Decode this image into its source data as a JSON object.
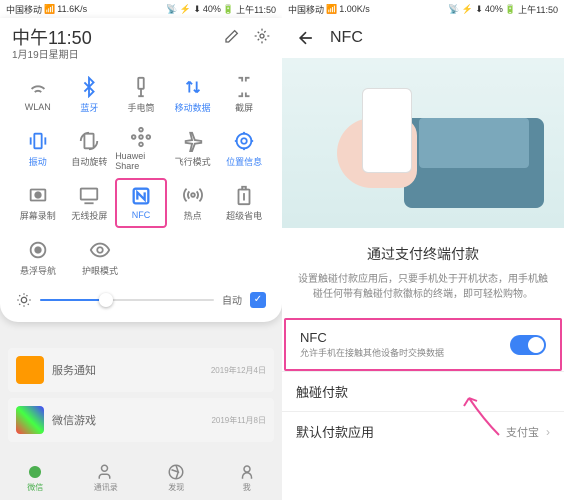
{
  "status": {
    "carrier": "中国移动",
    "speed_left": "11.6K/s",
    "speed_right": "1.00K/s",
    "battery": "40%",
    "time": "上午11:50"
  },
  "panel": {
    "time": "中午11:50",
    "date": "1月19日星期日",
    "tiles": [
      {
        "label": "WLAN",
        "active": false
      },
      {
        "label": "蓝牙",
        "active": true
      },
      {
        "label": "手电筒",
        "active": false
      },
      {
        "label": "移动数据",
        "active": true
      },
      {
        "label": "截屏",
        "active": false
      },
      {
        "label": "振动",
        "active": true
      },
      {
        "label": "自动旋转",
        "active": false
      },
      {
        "label": "Huawei Share",
        "active": false
      },
      {
        "label": "飞行模式",
        "active": false
      },
      {
        "label": "位置信息",
        "active": true
      },
      {
        "label": "屏幕录制",
        "active": false
      },
      {
        "label": "无线投屏",
        "active": false
      },
      {
        "label": "NFC",
        "active": true,
        "highlight": true
      },
      {
        "label": "热点",
        "active": false
      },
      {
        "label": "超级省电",
        "active": false
      }
    ],
    "floating": [
      {
        "label": "悬浮导航"
      },
      {
        "label": "护眼模式"
      }
    ],
    "brightness": {
      "auto_label": "自动",
      "auto_checked": true
    }
  },
  "bg": {
    "items": [
      {
        "title": "服务通知",
        "sub": "",
        "date": "2019年12月4日"
      },
      {
        "title": "微信游戏",
        "sub": "",
        "date": "2019年11月8日"
      }
    ]
  },
  "nav": [
    {
      "label": "微信"
    },
    {
      "label": "通讯录"
    },
    {
      "label": "发现"
    },
    {
      "label": "我"
    }
  ],
  "right": {
    "title": "NFC",
    "heading": "通过支付终端付款",
    "desc": "设置触碰付款应用后，只要手机处于开机状态，用手机触碰任何带有触碰付款徽标的终端，即可轻松购物。",
    "nfc": {
      "title": "NFC",
      "sub": "允许手机在接触其他设备时交换数据"
    },
    "touch_pay": "触碰付款",
    "default_app": {
      "label": "默认付款应用",
      "value": "支付宝"
    }
  }
}
